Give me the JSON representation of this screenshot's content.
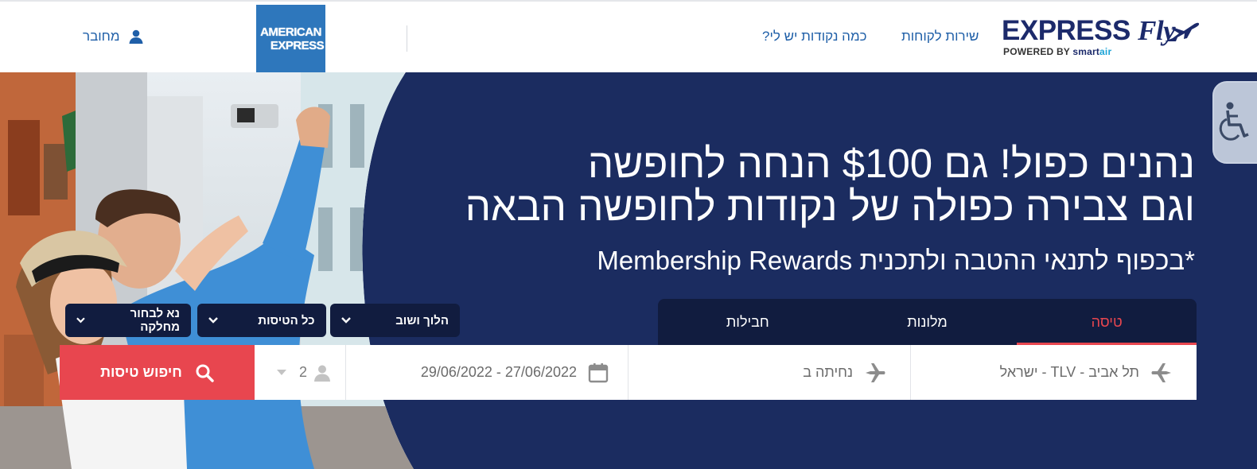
{
  "header": {
    "login_label": "מחובר",
    "amex_logo_line1": "AMERICAN",
    "amex_logo_line2": "EXPRESS",
    "points_link": "כמה נקודות יש לי?",
    "service_link": "שירות לקוחות",
    "brand_express": "EXPRESS",
    "brand_fly": "Fly",
    "brand_powered": "POWERED BY",
    "brand_smart": "smart",
    "brand_air": "air"
  },
  "hero": {
    "headline_line1": "נהנים כפול! גם $100 הנחה לחופשה",
    "headline_line2": "וגם צבירה כפולה של נקודות לחופשה הבאה",
    "subline": "*בכפוף לתנאי ההטבה ולתכנית Membership Rewards"
  },
  "tabs": [
    {
      "label": "טיסה",
      "active": true
    },
    {
      "label": "מלונות",
      "active": false
    },
    {
      "label": "חבילות",
      "active": false
    }
  ],
  "options": {
    "trip_type": "הלוך ושוב",
    "airlines": "כל הטיסות",
    "cabin_class": "נא לבחור מחלקה"
  },
  "search": {
    "from_value": "תל אביב - TLV - ישראל",
    "to_placeholder": "נחיתה ב",
    "dates_value": "29/06/2022 - 27/06/2022",
    "passengers": "2",
    "submit_label": "חיפוש טיסות"
  },
  "colors": {
    "navy": "#1b2c60",
    "panel": "#111c3f",
    "accent": "#e8464f",
    "link": "#1f5fa8",
    "amex": "#2e77bc"
  }
}
